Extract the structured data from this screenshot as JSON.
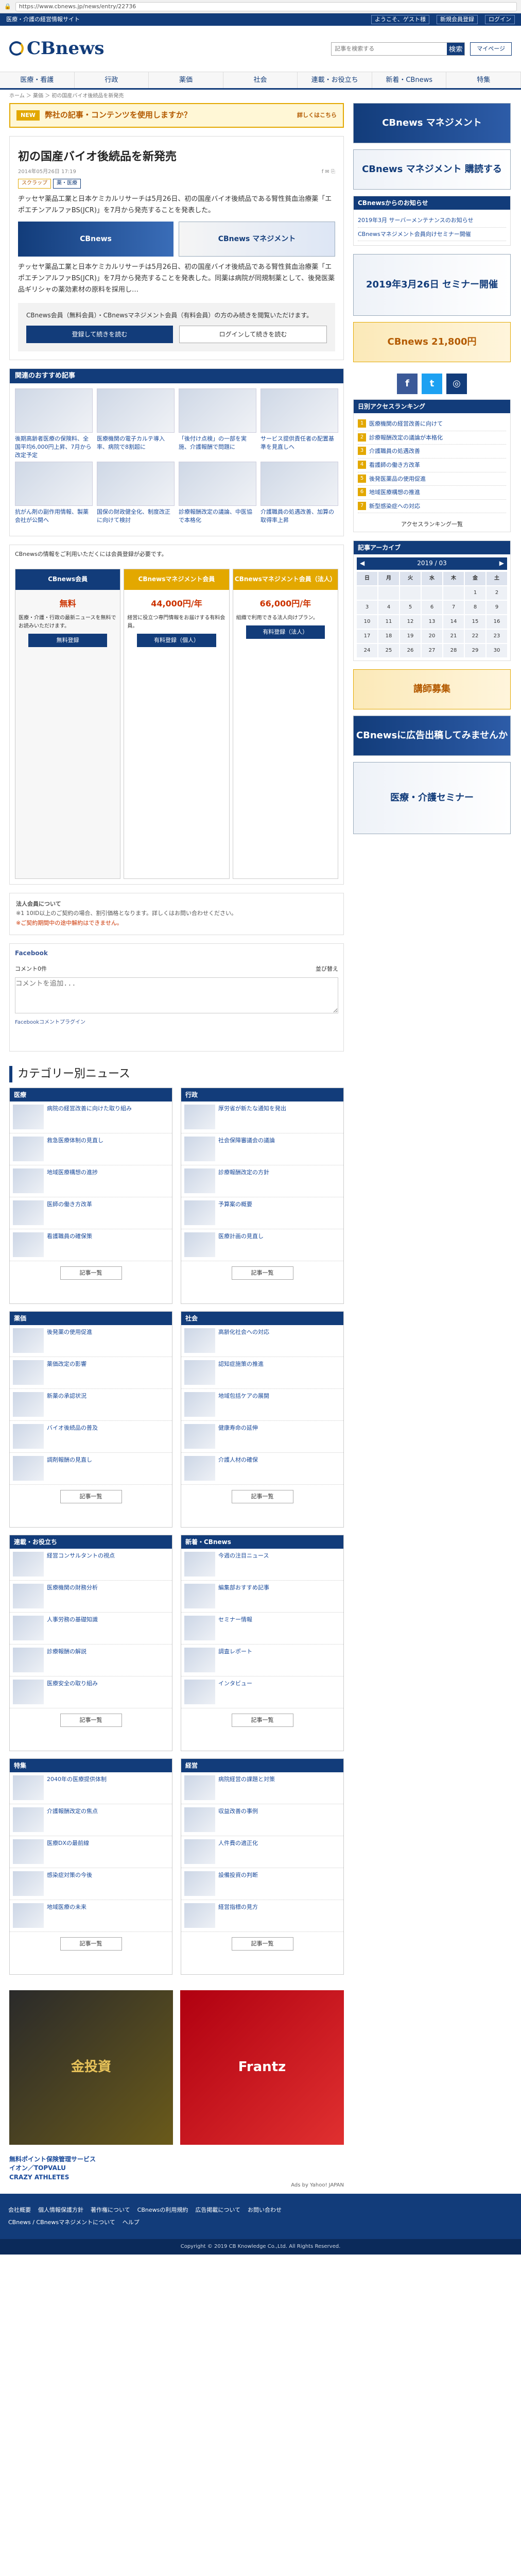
{
  "browser": {
    "url": "https://www.cbnews.jp/news/entry/22736"
  },
  "topbar": {
    "left": "医療・介護の経営情報サイト",
    "links": [
      "ようこそ、ゲスト様",
      "新規会員登録",
      "ログイン"
    ]
  },
  "header": {
    "logo": "CBnews",
    "search_placeholder": "記事を検索する",
    "search_button": "検索",
    "btn_mypage": "マイページ"
  },
  "nav": [
    "医療・看護",
    "行政",
    "薬価",
    "社会",
    "連載・お役立ち",
    "新着・CBnews",
    "特集"
  ],
  "breadcrumb": "ホーム ＞ 薬価 ＞ 初の国産バイオ後続品を新発売",
  "notice": {
    "badge": "NEW",
    "text": "弊社の記事・コンテンツを使用しますか？",
    "link": "詳しくはこちら"
  },
  "article": {
    "title": "初の国産バイオ後続品を新発売",
    "date": "2014年05月26日 17:19",
    "tags": [
      "スクラップ",
      "薬・医療"
    ],
    "body": "ヂッセヤ薬品工業と日本ケミカルリサーチは5月26日、初の国産バイオ後続品である腎性貧血治療薬「エポエチンアルファBS(JCR)」を7月から発売することを発表した。",
    "body2": "ヂッセヤ薬品工業と日本ケミカルリサーチは5月26日、初の国産バイオ後続品である腎性貧血治療薬「エポエチンアルファBS(JCR)」を7月から発売することを発表した。同薬は病院が同規制薬として、後発医薬品ギリシャの薬効素材の原料を採用し…",
    "register_text": "CBnews会員（無料会員）・CBnewsマネジメント会員（有料会員）の方のみ続きを閲覧いただけます。",
    "btn_register": "登録して続きを読む",
    "btn_login": "ログインして続きを読む"
  },
  "related": {
    "header": "関連のおすすめ記事",
    "items": [
      "後期高齢者医療の保険料、全国平均6,000円上昇、7月から改定予定",
      "医療機関の電子カルテ導入率、病院で8割超に",
      "「後付け点検」の一部を実施、介護報酬で問題に",
      "サービス提供責任者の配置基準を見直しへ",
      "抗がん剤の副作用情報、製薬会社が公開へ",
      "国保の財政健全化、制度改正に向けて検討",
      "診療報酬改定の議論、中医協で本格化",
      "介護職員の処遇改善、加算の取得率上昇"
    ]
  },
  "plans": {
    "lead": "CBnewsの情報をご利用いただくには会員登録が必要です。",
    "items": [
      {
        "name": "CBnews会員",
        "price": "無料",
        "desc": "医療・介護・行政の最新ニュースを無料でお読みいただけます。",
        "btn": "無料登録"
      },
      {
        "name": "CBnewsマネジメント会員",
        "price": "44,000円/年",
        "desc": "経営に役立つ専門情報をお届けする有料会員。",
        "btn": "有料登録（個人）"
      },
      {
        "name": "CBnewsマネジメント会員（法人）",
        "price": "66,000円/年",
        "desc": "組織で利用できる法人向けプラン。",
        "btn": "有料登録（法人）"
      }
    ]
  },
  "notes": {
    "title": "法人会員について",
    "text": "※1 10ID以上のご契約の場合、割引価格となります。詳しくはお問い合わせください。",
    "warn": "※ご契約期間中の途中解約はできません。"
  },
  "facebook": {
    "header": "Facebook",
    "comments_label": "コメント0件",
    "sort_label": "並び替え",
    "placeholder": "コメントを追加...",
    "plugin": "Facebookコメントプラグイン"
  },
  "categories": {
    "title": "カテゴリー別ニュース",
    "more": "記事一覧",
    "items": [
      {
        "name": "医療",
        "news": [
          "病院の経営改善に向けた取り組み",
          "救急医療体制の見直し",
          "地域医療構想の進捗",
          "医師の働き方改革",
          "看護職員の確保策"
        ]
      },
      {
        "name": "行政",
        "news": [
          "厚労省が新たな通知を発出",
          "社会保障審議会の議論",
          "診療報酬改定の方針",
          "予算案の概要",
          "医療計画の見直し"
        ]
      },
      {
        "name": "薬価",
        "news": [
          "後発薬の使用促進",
          "薬価改定の影響",
          "新薬の承認状況",
          "バイオ後続品の普及",
          "調剤報酬の見直し"
        ]
      },
      {
        "name": "社会",
        "news": [
          "高齢化社会への対応",
          "認知症施策の推進",
          "地域包括ケアの展開",
          "健康寿命の延伸",
          "介護人材の確保"
        ]
      },
      {
        "name": "連載・お役立ち",
        "news": [
          "経営コンサルタントの視点",
          "医療機関の財務分析",
          "人事労務の基礎知識",
          "診療報酬の解説",
          "医療安全の取り組み"
        ]
      },
      {
        "name": "新着・CBnews",
        "news": [
          "今週の注目ニュース",
          "編集部おすすめ記事",
          "セミナー情報",
          "調査レポート",
          "インタビュー"
        ]
      },
      {
        "name": "特集",
        "news": [
          "2040年の医療提供体制",
          "介護報酬改定の焦点",
          "医療DXの最前線",
          "感染症対策の今後",
          "地域医療の未来"
        ]
      },
      {
        "name": "経営",
        "news": [
          "病院経営の課題と対策",
          "収益改善の事例",
          "人件費の適正化",
          "設備投資の判断",
          "経営指標の見方"
        ]
      }
    ]
  },
  "banners": {
    "left": "金投資",
    "right": "Frantz"
  },
  "adtext": {
    "t1": "無料ポイント保険管理サービス",
    "t2": "イオン／TOPVALU",
    "t3": "CRAZY ATHLETES",
    "label": "Ads by Yahoo! JAPAN"
  },
  "sidebar": {
    "ad1": "CBnews マネジメント",
    "ad2": "CBnews マネジメント 購読する",
    "notice_title": "CBnewsからのお知らせ",
    "notice_items": [
      "2019年3月 サーバーメンテナンスのお知らせ",
      "CBnewsマネジメント会員向けセミナー開催"
    ],
    "ad3": "2019年3月26日 セミナー開催",
    "ad4": "CBnews 21,800円",
    "ranking_title": "日別アクセスランキング",
    "ranking": [
      "医療機関の経営改善に向けて",
      "診療報酬改定の議論が本格化",
      "介護職員の処遇改善",
      "看護師の働き方改革",
      "後発医薬品の使用促進",
      "地域医療構想の推進",
      "新型感染症への対応"
    ],
    "ranking_more": "アクセスランキング一覧",
    "calendar_title": "記事アーカイブ",
    "calendar_month": "2019 / 03",
    "weekdays": [
      "日",
      "月",
      "火",
      "水",
      "木",
      "金",
      "土"
    ],
    "ad5": "講師募集",
    "ad6": "CBnewsに広告出稿してみませんか",
    "ad7": "医療・介護セミナー"
  },
  "footer": {
    "links": [
      "会社概要",
      "個人情報保護方針",
      "著作権について",
      "CBnewsの利用規約",
      "広告掲載について",
      "お問い合わせ"
    ],
    "links2": [
      "CBnews / CBnewsマネジメントについて",
      "ヘルプ"
    ],
    "copyright": "Copyright © 2019 CB Knowledge Co.,Ltd. All Rights Reserved."
  }
}
